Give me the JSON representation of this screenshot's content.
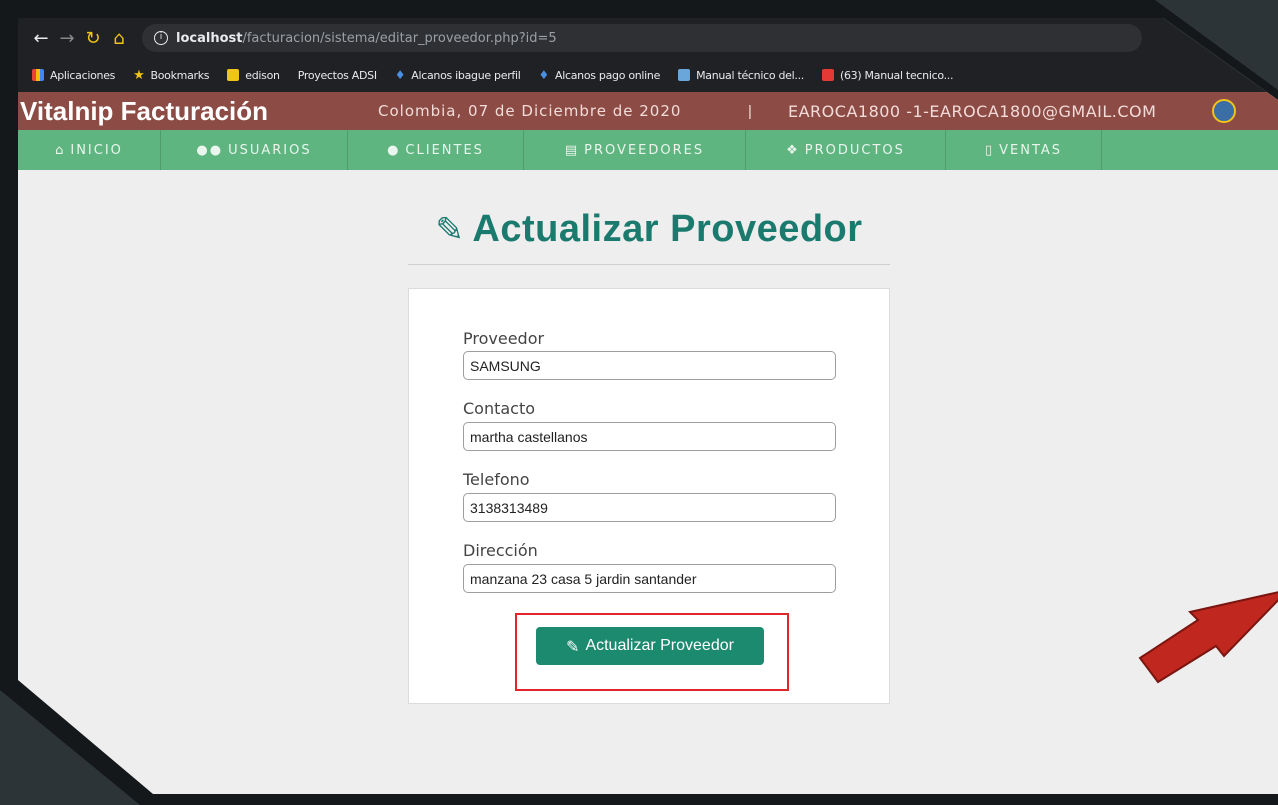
{
  "browser": {
    "url_host": "localhost",
    "url_path": "/facturacion/sistema/editar_proveedor.php?id=5",
    "bookmarks": [
      {
        "label": "Aplicaciones",
        "icon": "apps-grid-icon"
      },
      {
        "label": "Bookmarks",
        "icon": "star-icon"
      },
      {
        "label": "edison",
        "icon": "folder-icon"
      },
      {
        "label": "Proyectos ADSI",
        "icon": "none"
      },
      {
        "label": "Alcanos ibague perfil",
        "icon": "flame-icon"
      },
      {
        "label": "Alcanos pago online",
        "icon": "flame-icon"
      },
      {
        "label": "Manual técnico del...",
        "icon": "document-icon"
      },
      {
        "label": "(63) Manual tecnico...",
        "icon": "youtube-icon"
      }
    ]
  },
  "header": {
    "brand": "Vitalnip Facturación",
    "date": "Colombia, 07 de Diciembre de 2020",
    "separator": "|",
    "user": "EAROCA1800 -1-EAROCA1800@GMAIL.COM"
  },
  "menu": [
    {
      "label": "INICIO",
      "icon": "home-icon"
    },
    {
      "label": "USUARIOS",
      "icon": "users-icon"
    },
    {
      "label": "CLIENTES",
      "icon": "user-icon"
    },
    {
      "label": "PROVEEDORES",
      "icon": "building-icon"
    },
    {
      "label": "PRODUCTOS",
      "icon": "cubes-icon"
    },
    {
      "label": "VENTAS",
      "icon": "file-icon"
    }
  ],
  "page": {
    "title": "Actualizar Proveedor"
  },
  "form": {
    "proveedor_label": "Proveedor",
    "proveedor_value": "SAMSUNG",
    "contacto_label": "Contacto",
    "contacto_value": "martha castellanos",
    "telefono_label": "Telefono",
    "telefono_value": "3138313489",
    "direccion_label": "Dirección",
    "direccion_value": "manzana 23 casa 5 jardin santander",
    "submit_label": "Actualizar Proveedor"
  },
  "colors": {
    "header_bg": "#8c4b44",
    "menu_bg": "#5fb57f",
    "accent": "#1b8a6f",
    "highlight": "#e0262a",
    "arrow": "#c0281f"
  }
}
